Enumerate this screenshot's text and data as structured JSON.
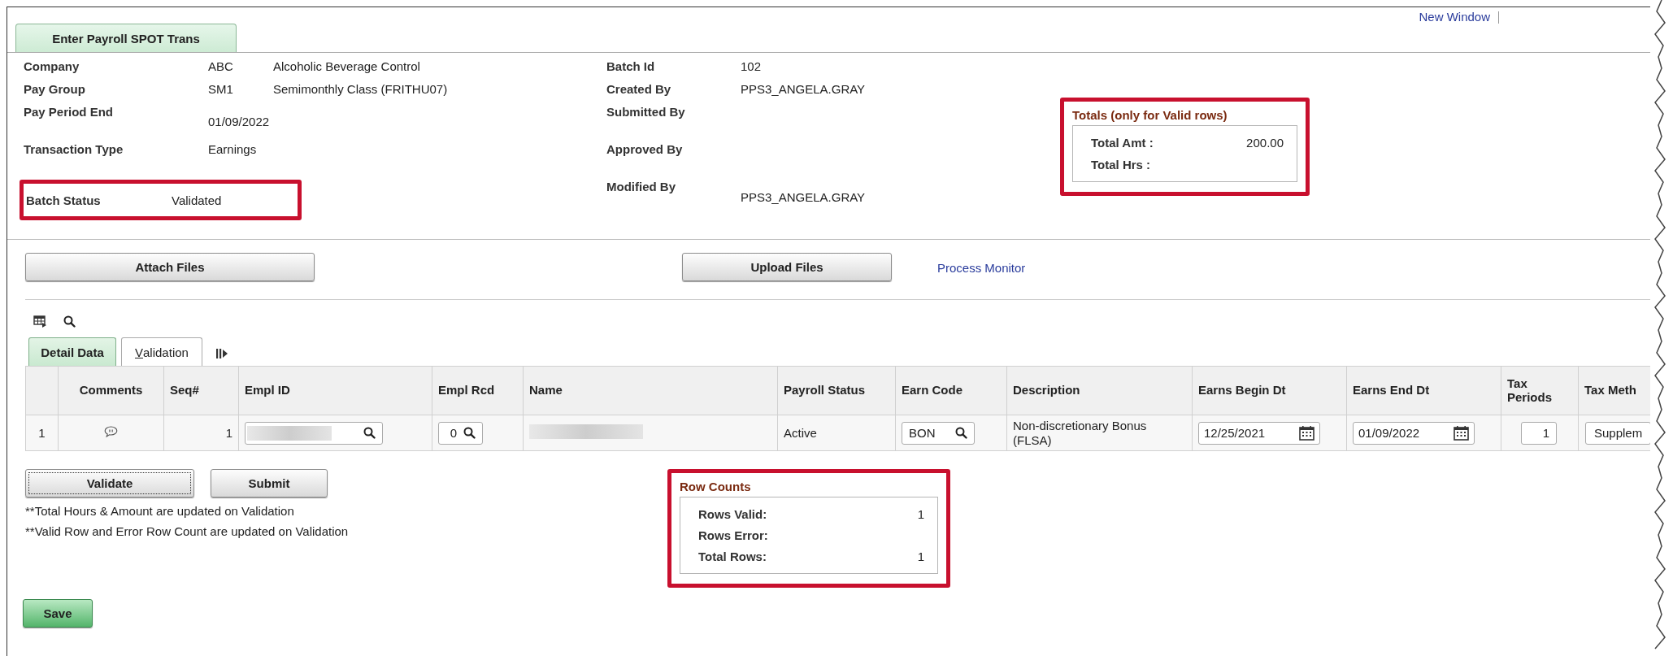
{
  "header_link": "New Window",
  "page_tab": {
    "label": "Enter Payroll SPOT Trans",
    "selected": true
  },
  "fields_left": [
    {
      "label": "Company",
      "value": "ABC",
      "description": "Alcoholic Beverage Control"
    },
    {
      "label": "Pay Group",
      "value": "SM1",
      "description": "Semimonthly Class (FRITHU07)"
    },
    {
      "label": "Pay Period End",
      "value": "01/09/2022"
    },
    {
      "label": "Transaction Type",
      "value": "Earnings"
    },
    {
      "label": "Batch Status",
      "value": "Validated",
      "highlighted": true
    }
  ],
  "fields_right": [
    {
      "label": "Batch Id",
      "value": "102"
    },
    {
      "label": "Created By",
      "value": "PPS3_ANGELA.GRAY"
    },
    {
      "label": "Submitted By"
    },
    {
      "label": "Approved By"
    },
    {
      "label": "Modified By",
      "value": "PPS3_ANGELA.GRAY"
    }
  ],
  "totals": {
    "title": "Totals (only for Valid rows)",
    "highlighted": true,
    "items": [
      {
        "label": "Total Amt :",
        "value": "200.00"
      },
      {
        "label": "Total Hrs :"
      }
    ]
  },
  "actions": {
    "attach": "Attach Files",
    "upload": "Upload Files",
    "link": "Process Monitor"
  },
  "grid": {
    "tabs": [
      {
        "label": "Detail Data",
        "selected": true
      },
      {
        "label": "Validation",
        "selected": false
      }
    ],
    "columns": [
      "Comments",
      "Seq#",
      "Empl ID",
      "Empl Rcd",
      "Name",
      "Payroll Status",
      "Earn Code",
      "Description",
      "Earns Begin Dt",
      "Earns End Dt",
      "Tax Periods",
      "Tax Meth"
    ],
    "rows": [
      {
        "row_number": "1",
        "cells": [
          {
            "kind": "comment"
          },
          {
            "kind": "number",
            "value": "1"
          },
          {
            "kind": "lookup",
            "redacted": true
          },
          {
            "kind": "lookup",
            "value": "0"
          },
          {
            "kind": "text",
            "redacted": true
          },
          {
            "kind": "text",
            "value": "Active"
          },
          {
            "kind": "lookup",
            "value": "BON"
          },
          {
            "kind": "text",
            "value": "Non-discretionary Bonus (FLSA)"
          },
          {
            "kind": "date",
            "value": "12/25/2021"
          },
          {
            "kind": "date",
            "value": "01/09/2022"
          },
          {
            "kind": "number-field",
            "value": "1"
          },
          {
            "kind": "dropdown",
            "value": "Supplem"
          }
        ]
      }
    ]
  },
  "buttons": [
    {
      "label": "Validate",
      "focused": true
    },
    {
      "label": "Submit",
      "focused": false
    }
  ],
  "notes": [
    "**Total Hours & Amount are updated on Validation",
    "**Valid Row and Error Row Count are updated on Validation"
  ],
  "row_counts": {
    "title": "Row Counts",
    "highlighted": true,
    "items": [
      {
        "label": "Rows Valid:",
        "value": "1"
      },
      {
        "label": "Rows Error:"
      },
      {
        "label": "Total Rows:",
        "value": "1"
      }
    ]
  },
  "save": "Save"
}
